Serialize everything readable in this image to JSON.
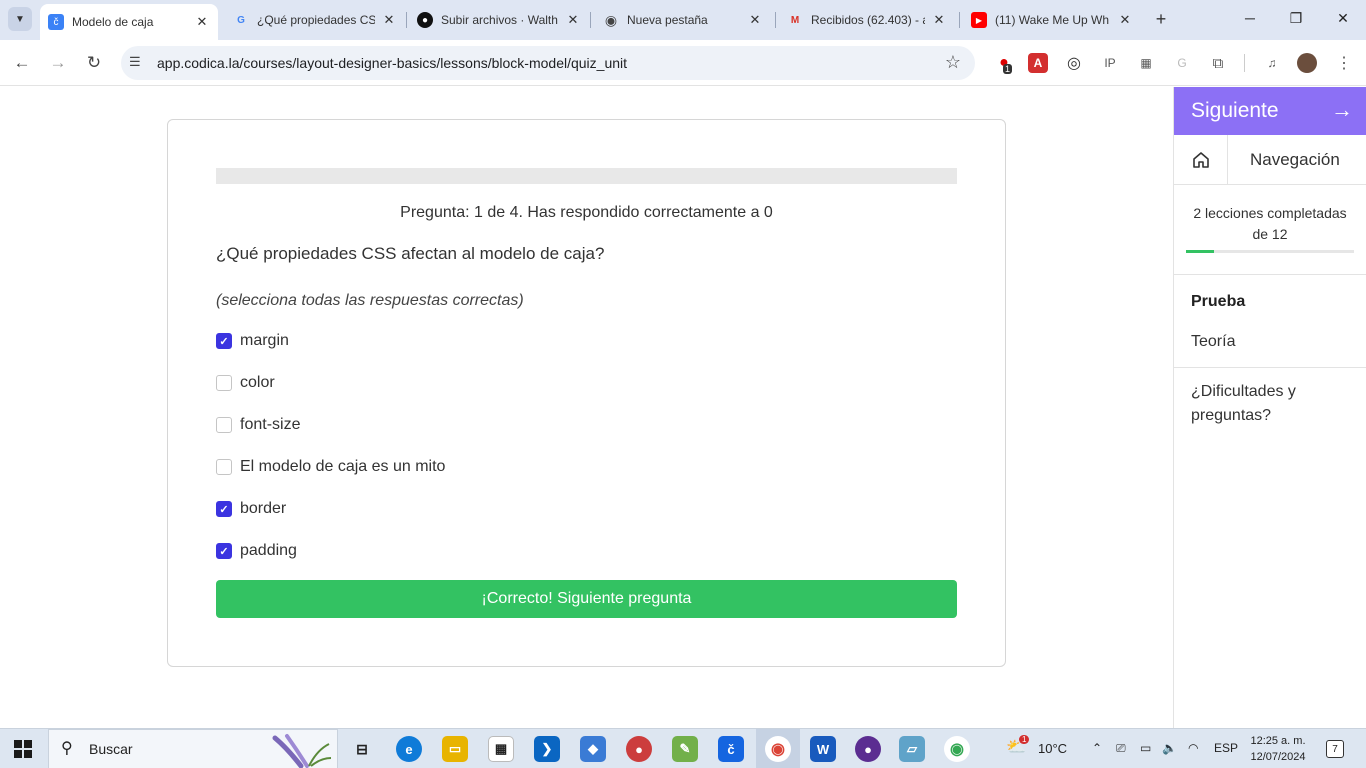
{
  "browser": {
    "tabs": [
      {
        "title": "Modelo de caja",
        "favicon": "codica-icon",
        "color": "#3b82f6",
        "glyph": "č"
      },
      {
        "title": "¿Qué propiedades CS",
        "favicon": "google-icon",
        "color": "#ffffff",
        "glyph": "G"
      },
      {
        "title": "Subir archivos · Walth",
        "favicon": "github-icon",
        "color": "#ffffff",
        "glyph": "●"
      },
      {
        "title": "Nueva pestaña",
        "favicon": "chrome-icon",
        "color": "#ffffff",
        "glyph": "◉"
      },
      {
        "title": "Recibidos (62.403) - a",
        "favicon": "gmail-icon",
        "color": "#ffffff",
        "glyph": "M"
      },
      {
        "title": "(11) Wake Me Up Wh",
        "favicon": "youtube-icon",
        "color": "#ff0000",
        "glyph": "▶"
      }
    ],
    "url": "app.codica.la/courses/layout-designer-basics/lessons/block-model/quiz_unit",
    "extension_badge": "1"
  },
  "quiz": {
    "progress": 0,
    "counter_text": "Pregunta: 1 de 4. Has respondido correctamente a 0",
    "question": "¿Qué propiedades CSS afectan al modelo de caja?",
    "hint": "(selecciona todas las respuestas correctas)",
    "options": [
      {
        "label": "margin",
        "checked": true
      },
      {
        "label": "color",
        "checked": false
      },
      {
        "label": "font-size",
        "checked": false
      },
      {
        "label": "El modelo de caja es un mito",
        "checked": false
      },
      {
        "label": "border",
        "checked": true
      },
      {
        "label": "padding",
        "checked": true
      }
    ],
    "submit_label": "¡Correcto! Siguiente pregunta",
    "accent_color": "#3b34e0",
    "success_color": "#33c262"
  },
  "sidebar": {
    "next_label": "Siguiente",
    "next_arrow": "→",
    "nav_label": "Navegación",
    "lessons_text": "2 lecciones completadas de 12",
    "lessons_completed": 2,
    "lessons_total": 12,
    "items": [
      {
        "label": "Prueba"
      },
      {
        "label": "Teoría"
      },
      {
        "label": "¿Dificultades y preguntas?"
      }
    ],
    "brand_color": "#8c70f5"
  },
  "taskbar": {
    "search_placeholder": "Buscar",
    "weather": "10°C",
    "language": "ESP",
    "time": "12:25 a. m.",
    "date": "12/07/2024",
    "notification_count": "7",
    "weather_badge": "1"
  }
}
